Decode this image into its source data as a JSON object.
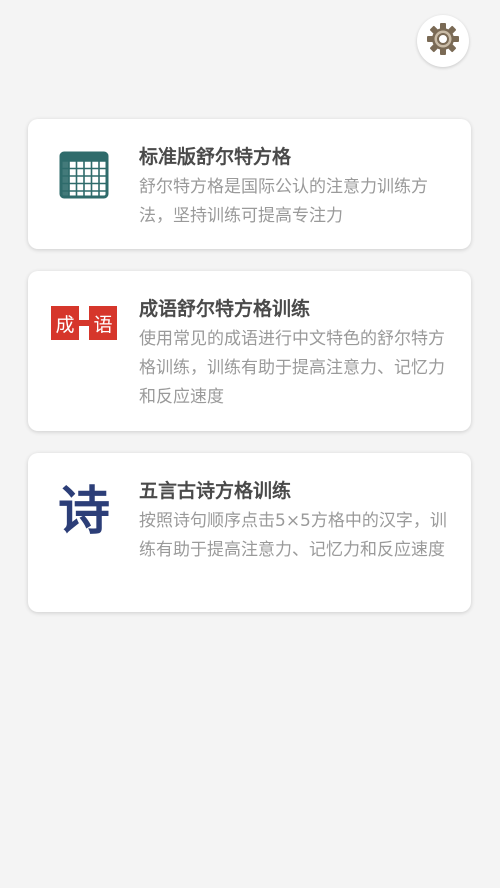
{
  "settings": {
    "icon": "gear-icon"
  },
  "cards": [
    {
      "icon": "grid-table-icon",
      "title": "标准版舒尔特方格",
      "description": "舒尔特方格是国际公认的注意力训练方法，坚持训练可提高专注力"
    },
    {
      "icon": "idiom-stamp-icon",
      "title": "成语舒尔特方格训练",
      "description": "使用常见的成语进行中文特色的舒尔特方格训练，训练有助于提高注意力、记忆力和反应速度",
      "icon_text": "成语"
    },
    {
      "icon": "poem-character-icon",
      "title": "五言古诗方格训练",
      "description": "按照诗句顺序点击5×5方格中的汉字，训练有助于提高注意力、记忆力和反应速度",
      "icon_text": "诗"
    }
  ],
  "colors": {
    "background": "#f4f4f4",
    "card_background": "#ffffff",
    "title_text": "#4a4a4a",
    "desc_text": "#9a9a9a",
    "grid_icon": "#2f6b6b",
    "idiom_red": "#d6362b",
    "poem_blue": "#2c3e78"
  }
}
